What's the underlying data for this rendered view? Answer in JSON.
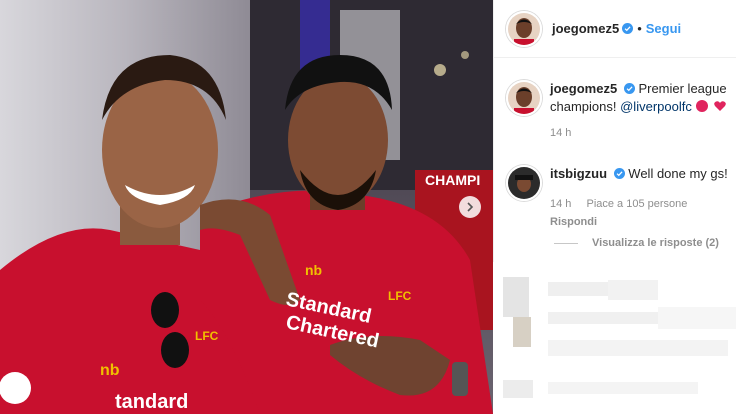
{
  "header": {
    "username": "joegomez5",
    "follow_label": "Segui",
    "dot": "•"
  },
  "caption": {
    "username": "joegomez5",
    "text": "Premier league champions!",
    "mention": "@liverpoolfc",
    "time": "14 h"
  },
  "comment": {
    "username": "itsbigzuu",
    "text": "Well done my gs!",
    "time": "14 h",
    "likes": "Piace a 105 persone",
    "reply_label": "Rispondi"
  },
  "replies_link": "Visualizza le risposte (2)",
  "colors": {
    "jersey": "#c8102e",
    "verified": "#3897f0",
    "accent": "#3897f0"
  },
  "icons": [
    "verified-badge-icon",
    "red-heart-icon",
    "chevron-right-icon"
  ]
}
